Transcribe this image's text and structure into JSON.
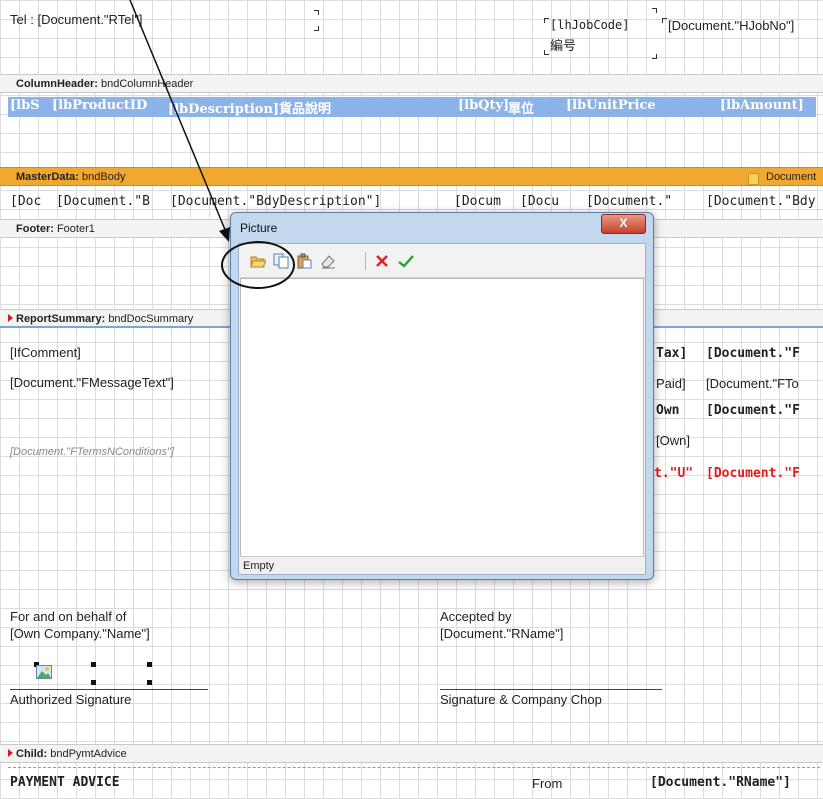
{
  "report": {
    "tel_field": "Tel : [Document.\"RTel\"]",
    "job_code_field": "[lhJobCode]",
    "job_code_chinese": "編号",
    "job_no_field": "[Document.\"HJobNo\"]",
    "column_header_band": {
      "bold": "ColumnHeader:",
      "name": "bndColumnHeader"
    },
    "column_headers": [
      "[lbS",
      "[lbProductID",
      "[lbDescription]貨品說明",
      "[lbQty]",
      "單位",
      "[lbUnitPrice",
      "[lbAmount]"
    ],
    "master_band": {
      "bold": "MasterData:",
      "name": "bndBody",
      "source": "Document"
    },
    "body_fields": [
      "[Doc",
      "[Document.\"B",
      "[Document.\"BdyDescription\"]",
      "[Docum",
      "[Docu",
      "[Document.\"",
      "[Document.\"Bdy"
    ],
    "footer_band": {
      "bold": "Footer:",
      "name": "Footer1"
    },
    "summary_band": {
      "bold": "ReportSummary:",
      "name": "bndDocSummary"
    },
    "summary_left": {
      "comment": "[IfComment]",
      "message": "[Document.\"FMessageText\"]",
      "terms": "[Document.\"FTermsNConditions\"]"
    },
    "summary_right": {
      "tax_label": "Tax]",
      "tax_value": "[Document.\"F",
      "paid_label": "Paid]",
      "paid_value": "[Document.\"FTo",
      "own_label": "Own",
      "own_value": "[Document.\"F",
      "own_label2": "[Own]",
      "u_label": "t.\"U\"",
      "u_value": "[Document.\"F"
    },
    "signature_left": {
      "line1": "For and on behalf of",
      "line2": "[Own Company.\"Name\"]",
      "caption": "Authorized Signature"
    },
    "signature_right": {
      "line1": "Accepted by",
      "line2": "[Document.\"RName\"]",
      "caption": "Signature & Company Chop"
    },
    "child_band": {
      "bold": "Child:",
      "name": "bndPymtAdvice"
    },
    "payment_advice": "PAYMENT ADVICE",
    "from_label": "From",
    "rname_field": "[Document.\"RName\"]"
  },
  "dialog": {
    "title": "Picture",
    "close_label": "X",
    "status": "Empty",
    "toolbar": {
      "open": "folder-open-icon",
      "copy": "copy-icon",
      "paste": "paste-icon",
      "clear": "eraser-icon",
      "cancel": "cancel-icon",
      "ok": "check-icon"
    }
  },
  "colors": {
    "header_strip": "#8cb3e8",
    "master_band": "#f0a830",
    "highlight_red": "#e21b1b",
    "cancel_red": "#e02020",
    "ok_green": "#2e9e2e"
  }
}
